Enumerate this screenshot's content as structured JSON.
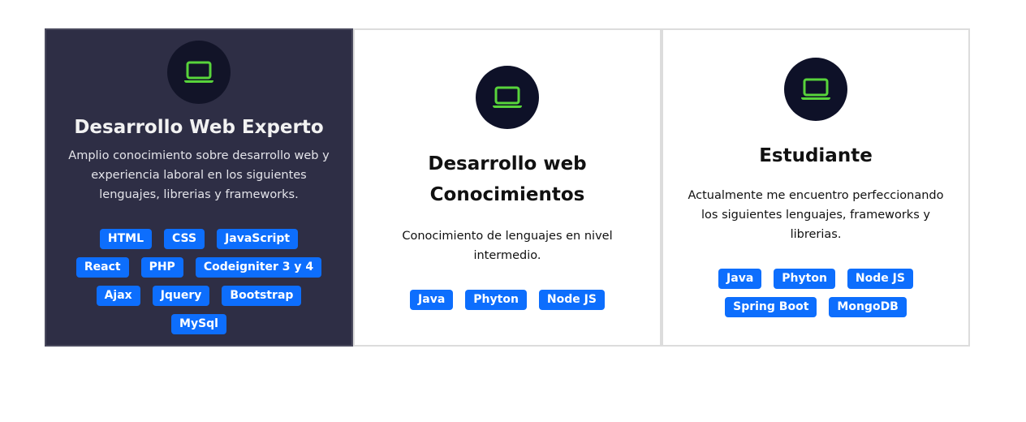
{
  "cards": [
    {
      "title": "Desarrollo Web Experto",
      "description": "Amplio conocimiento sobre desarrollo web y experiencia laboral en los siguientes lenguajes, librerias y frameworks.",
      "icon": "laptop-icon",
      "tags": [
        "HTML",
        "CSS",
        "JavaScript",
        "React",
        "PHP",
        "Codeigniter 3 y 4",
        "Ajax",
        "Jquery",
        "Bootstrap",
        "MySql"
      ]
    },
    {
      "title_line1": "Desarrollo web",
      "title_line2": "Conocimientos",
      "description": "Conocimiento de lenguajes en nivel intermedio.",
      "icon": "laptop-icon",
      "tags": [
        "Java",
        "Phyton",
        "Node JS"
      ]
    },
    {
      "title": "Estudiante",
      "description": "Actualmente me encuentro perfeccionando los siguientes lenguajes, frameworks y librerias.",
      "icon": "laptop-icon",
      "tags": [
        "Java",
        "Phyton",
        "Node JS",
        "Spring Boot",
        "MongoDB"
      ]
    }
  ],
  "colors": {
    "dark_card_bg": "#2e2e45",
    "icon_circle": "#0e1128",
    "icon_green": "#58d43b",
    "tag_bg": "#0d6efd"
  }
}
